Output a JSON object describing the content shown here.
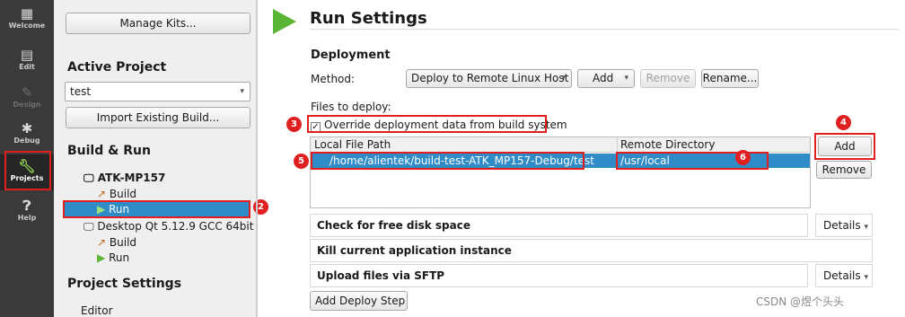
{
  "modebar": {
    "items": [
      {
        "label": "Welcome",
        "icon": "grid-icon"
      },
      {
        "label": "Edit",
        "icon": "document-icon"
      },
      {
        "label": "Design",
        "icon": "pencil-icon"
      },
      {
        "label": "Debug",
        "icon": "bug-icon"
      },
      {
        "label": "Projects",
        "icon": "wrench-icon"
      },
      {
        "label": "Help",
        "icon": "help-icon"
      }
    ]
  },
  "sidebar": {
    "manage_kits": "Manage Kits...",
    "active_project_title": "Active Project",
    "project_selected": "test",
    "import_button": "Import Existing Build...",
    "build_run_title": "Build & Run",
    "kits": [
      {
        "name": "ATK-MP157",
        "build": "Build",
        "run": "Run"
      },
      {
        "name": "Desktop Qt 5.12.9 GCC 64bit",
        "build": "Build",
        "run": "Run"
      }
    ],
    "project_settings_title": "Project Settings",
    "editor": "Editor"
  },
  "main": {
    "title": "Run Settings",
    "deployment_title": "Deployment",
    "method_label": "Method:",
    "method_value": "Deploy to Remote Linux Host",
    "add": "Add",
    "remove": "Remove",
    "rename": "Rename...",
    "files_to_deploy": "Files to deploy:",
    "override_label": "Override deployment data from build system",
    "override_checked": "✓",
    "columns": [
      "Local File Path",
      "Remote Directory"
    ],
    "rows": [
      {
        "local": "/home/alientek/build-test-ATK_MP157-Debug/test",
        "remote": "/usr/local"
      }
    ],
    "side_add": "Add",
    "side_remove": "Remove",
    "steps": [
      {
        "label": "Check for free disk space",
        "details": "Details"
      },
      {
        "label": "Kill current application instance",
        "details": ""
      },
      {
        "label": "Upload files via SFTP",
        "details": "Details"
      }
    ],
    "add_deploy_step": "Add Deploy Step"
  },
  "annotations": {
    "markers": [
      "1",
      "2",
      "3",
      "4",
      "5",
      "6"
    ]
  },
  "watermark": "CSDN @煜个头头",
  "colors": {
    "accent_green": "#5bb537",
    "selection_blue": "#308cc6",
    "annotation_red": "#e02020"
  }
}
